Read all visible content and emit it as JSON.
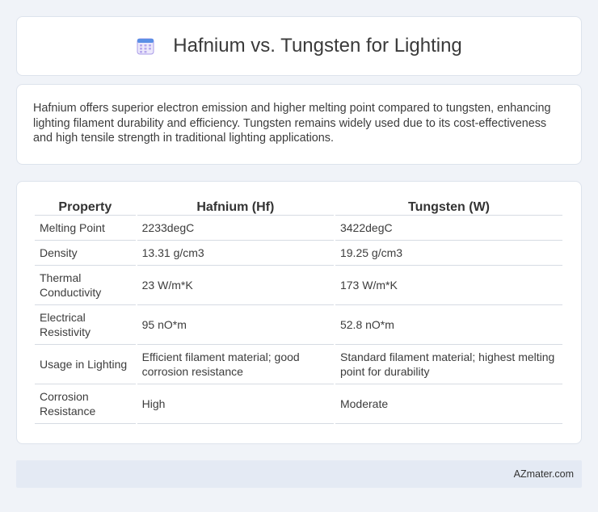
{
  "header": {
    "title": "Hafnium vs. Tungsten for Lighting",
    "icon": "calendar-icon"
  },
  "summary": {
    "text": "Hafnium offers superior electron emission and higher melting point compared to tungsten, enhancing lighting filament durability and efficiency. Tungsten remains widely used due to its cost-effectiveness and high tensile strength in traditional lighting applications."
  },
  "table": {
    "headers": [
      "Property",
      "Hafnium (Hf)",
      "Tungsten (W)"
    ],
    "rows": [
      [
        "Melting Point",
        "2233degC",
        "3422degC"
      ],
      [
        "Density",
        "13.31 g/cm3",
        "19.25 g/cm3"
      ],
      [
        "Thermal Conductivity",
        "23 W/m*K",
        "173 W/m*K"
      ],
      [
        "Electrical Resistivity",
        "95 nO*m",
        "52.8 nO*m"
      ],
      [
        "Usage in Lighting",
        "Efficient filament material; good corrosion resistance",
        "Standard filament material; highest melting point for durability"
      ],
      [
        "Corrosion Resistance",
        "High",
        "Moderate"
      ]
    ]
  },
  "footer": {
    "text": "AZmater.com"
  },
  "colors": {
    "background": "#f0f3f8",
    "card": "#ffffff",
    "footer_bar": "#e4eaf4",
    "icon_accent": "#7b6ad8"
  }
}
